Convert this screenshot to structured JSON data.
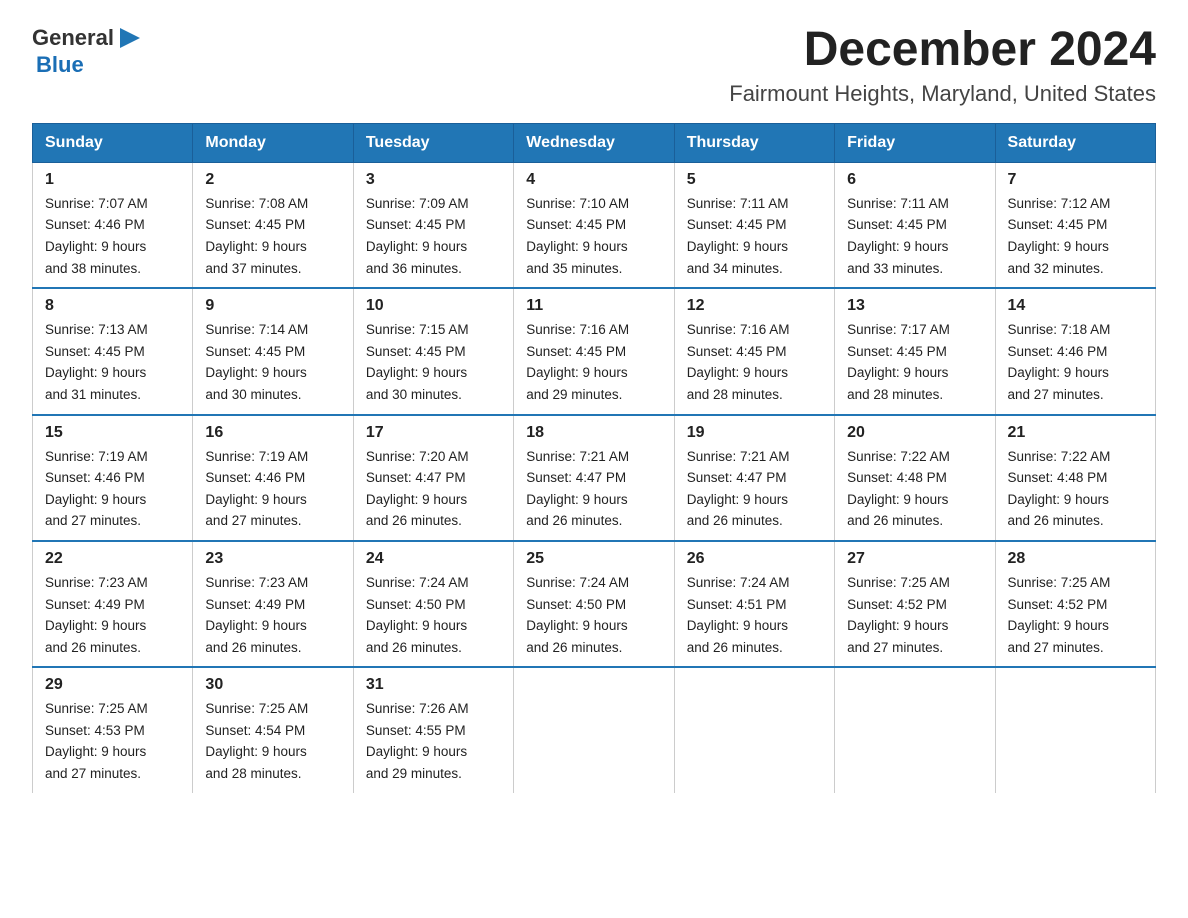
{
  "logo": {
    "text_general": "General",
    "text_blue": "Blue",
    "arrow_color": "#2176b5"
  },
  "header": {
    "title": "December 2024",
    "subtitle": "Fairmount Heights, Maryland, United States"
  },
  "days_of_week": [
    "Sunday",
    "Monday",
    "Tuesday",
    "Wednesday",
    "Thursday",
    "Friday",
    "Saturday"
  ],
  "weeks": [
    [
      {
        "day": "1",
        "sunrise": "7:07 AM",
        "sunset": "4:46 PM",
        "daylight": "9 hours and 38 minutes."
      },
      {
        "day": "2",
        "sunrise": "7:08 AM",
        "sunset": "4:45 PM",
        "daylight": "9 hours and 37 minutes."
      },
      {
        "day": "3",
        "sunrise": "7:09 AM",
        "sunset": "4:45 PM",
        "daylight": "9 hours and 36 minutes."
      },
      {
        "day": "4",
        "sunrise": "7:10 AM",
        "sunset": "4:45 PM",
        "daylight": "9 hours and 35 minutes."
      },
      {
        "day": "5",
        "sunrise": "7:11 AM",
        "sunset": "4:45 PM",
        "daylight": "9 hours and 34 minutes."
      },
      {
        "day": "6",
        "sunrise": "7:11 AM",
        "sunset": "4:45 PM",
        "daylight": "9 hours and 33 minutes."
      },
      {
        "day": "7",
        "sunrise": "7:12 AM",
        "sunset": "4:45 PM",
        "daylight": "9 hours and 32 minutes."
      }
    ],
    [
      {
        "day": "8",
        "sunrise": "7:13 AM",
        "sunset": "4:45 PM",
        "daylight": "9 hours and 31 minutes."
      },
      {
        "day": "9",
        "sunrise": "7:14 AM",
        "sunset": "4:45 PM",
        "daylight": "9 hours and 30 minutes."
      },
      {
        "day": "10",
        "sunrise": "7:15 AM",
        "sunset": "4:45 PM",
        "daylight": "9 hours and 30 minutes."
      },
      {
        "day": "11",
        "sunrise": "7:16 AM",
        "sunset": "4:45 PM",
        "daylight": "9 hours and 29 minutes."
      },
      {
        "day": "12",
        "sunrise": "7:16 AM",
        "sunset": "4:45 PM",
        "daylight": "9 hours and 28 minutes."
      },
      {
        "day": "13",
        "sunrise": "7:17 AM",
        "sunset": "4:45 PM",
        "daylight": "9 hours and 28 minutes."
      },
      {
        "day": "14",
        "sunrise": "7:18 AM",
        "sunset": "4:46 PM",
        "daylight": "9 hours and 27 minutes."
      }
    ],
    [
      {
        "day": "15",
        "sunrise": "7:19 AM",
        "sunset": "4:46 PM",
        "daylight": "9 hours and 27 minutes."
      },
      {
        "day": "16",
        "sunrise": "7:19 AM",
        "sunset": "4:46 PM",
        "daylight": "9 hours and 27 minutes."
      },
      {
        "day": "17",
        "sunrise": "7:20 AM",
        "sunset": "4:47 PM",
        "daylight": "9 hours and 26 minutes."
      },
      {
        "day": "18",
        "sunrise": "7:21 AM",
        "sunset": "4:47 PM",
        "daylight": "9 hours and 26 minutes."
      },
      {
        "day": "19",
        "sunrise": "7:21 AM",
        "sunset": "4:47 PM",
        "daylight": "9 hours and 26 minutes."
      },
      {
        "day": "20",
        "sunrise": "7:22 AM",
        "sunset": "4:48 PM",
        "daylight": "9 hours and 26 minutes."
      },
      {
        "day": "21",
        "sunrise": "7:22 AM",
        "sunset": "4:48 PM",
        "daylight": "9 hours and 26 minutes."
      }
    ],
    [
      {
        "day": "22",
        "sunrise": "7:23 AM",
        "sunset": "4:49 PM",
        "daylight": "9 hours and 26 minutes."
      },
      {
        "day": "23",
        "sunrise": "7:23 AM",
        "sunset": "4:49 PM",
        "daylight": "9 hours and 26 minutes."
      },
      {
        "day": "24",
        "sunrise": "7:24 AM",
        "sunset": "4:50 PM",
        "daylight": "9 hours and 26 minutes."
      },
      {
        "day": "25",
        "sunrise": "7:24 AM",
        "sunset": "4:50 PM",
        "daylight": "9 hours and 26 minutes."
      },
      {
        "day": "26",
        "sunrise": "7:24 AM",
        "sunset": "4:51 PM",
        "daylight": "9 hours and 26 minutes."
      },
      {
        "day": "27",
        "sunrise": "7:25 AM",
        "sunset": "4:52 PM",
        "daylight": "9 hours and 27 minutes."
      },
      {
        "day": "28",
        "sunrise": "7:25 AM",
        "sunset": "4:52 PM",
        "daylight": "9 hours and 27 minutes."
      }
    ],
    [
      {
        "day": "29",
        "sunrise": "7:25 AM",
        "sunset": "4:53 PM",
        "daylight": "9 hours and 27 minutes."
      },
      {
        "day": "30",
        "sunrise": "7:25 AM",
        "sunset": "4:54 PM",
        "daylight": "9 hours and 28 minutes."
      },
      {
        "day": "31",
        "sunrise": "7:26 AM",
        "sunset": "4:55 PM",
        "daylight": "9 hours and 29 minutes."
      },
      null,
      null,
      null,
      null
    ]
  ],
  "labels": {
    "sunrise": "Sunrise:",
    "sunset": "Sunset:",
    "daylight": "Daylight:"
  }
}
